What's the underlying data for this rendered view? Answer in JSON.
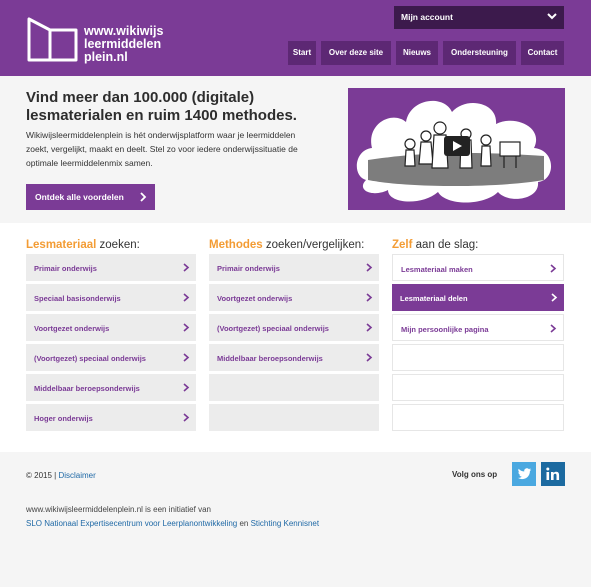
{
  "header": {
    "logo_lines": [
      "www.wikiwijs",
      "leermiddelen",
      "plein.nl"
    ],
    "account_label": "Mijn account",
    "nav": [
      "Start",
      "Over deze site",
      "Nieuws",
      "Ondersteuning",
      "Contact"
    ]
  },
  "hero": {
    "title": "Vind meer dan 100.000 (digitale) lesmaterialen en ruim 1400 methodes.",
    "text": "Wikiwijsleermiddelenplein is hét onderwijsplatform waar je leermiddelen zoekt, vergelijkt, maakt en deelt. Stel zo voor iedere onderwijssituatie de optimale leermiddelenmix samen.",
    "cta_label": "Ontdek alle voordelen"
  },
  "columns": [
    {
      "highlight": "Lesmateriaal",
      "rest": " zoeken:",
      "items": [
        "Primair onderwijs",
        "Speciaal basisonderwijs",
        "Voortgezet onderwijs",
        "(Voortgezet) speciaal onderwijs",
        "Middelbaar beroepsonderwijs",
        "Hoger onderwijs"
      ]
    },
    {
      "highlight": "Methodes",
      "rest": " zoeken/vergelijken:",
      "items": [
        "Primair onderwijs",
        "Voortgezet onderwijs",
        "(Voortgezet) speciaal onderwijs",
        "Middelbaar beroepsonderwijs"
      ]
    },
    {
      "highlight": "Zelf",
      "rest": " aan de slag:",
      "items": [
        "Lesmateriaal maken",
        "Lesmateriaal delen",
        "Mijn persoonlijke pagina"
      ]
    }
  ],
  "footer": {
    "copyright": "© 2015 |",
    "disclaimer": "Disclaimer",
    "follow": "Volg ons op",
    "initiative_text": "www.wikiwijsleermiddelenplein.nl is een initiatief van",
    "slo": "SLO Nationaal Expertisecentrum voor Leerplanontwikkeling",
    "and": " en ",
    "kennisnet": "Stichting Kennisnet"
  },
  "colors": {
    "brand": "#7b3b96",
    "accent": "#f39c34",
    "link": "#1f69a6"
  }
}
